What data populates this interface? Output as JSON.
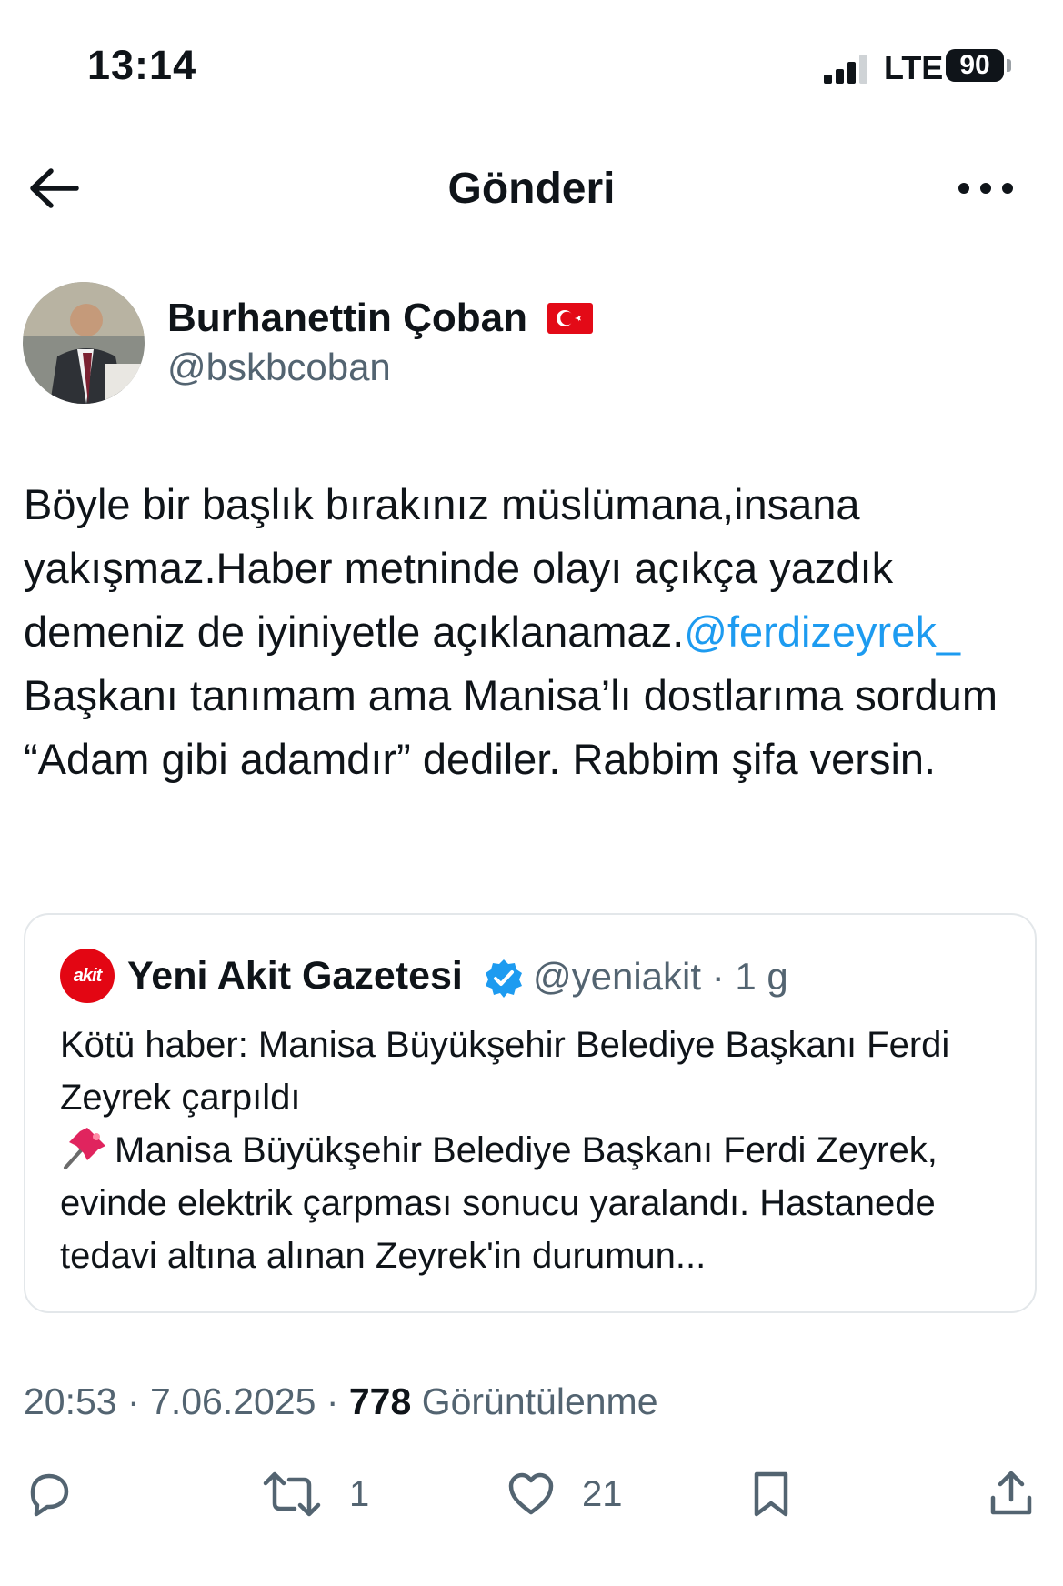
{
  "status_bar": {
    "time": "13:14",
    "network": "LTE",
    "battery": "90"
  },
  "header": {
    "title": "Gönderi",
    "back_icon": "arrow-left-icon",
    "more_icon": "more-horizontal-icon"
  },
  "author": {
    "name": "Burhanettin Çoban",
    "handle": "@bskbcoban",
    "flag_icon": "turkey-flag-icon"
  },
  "tweet": {
    "text_part1": "Böyle bir başlık bırakınız müslümana,insana yakışmaz.Haber metninde olayı açıkça yazdık demeniz de iyiniyetle açıklanamaz.",
    "mention": "@ferdizeyrek_",
    "text_part2": " Başkanı tanımam ama Manisa’lı dostlarıma sordum “Adam gibi adamdır” dediler. Rabbim şifa versin."
  },
  "quote": {
    "logo_text": "akit",
    "name": "Yeni Akit Gazetesi",
    "handle_meta": "@yeniakit · 1 g",
    "line1": "Kötü haber: Manisa Büyükşehir Belediye Başkanı Ferdi Zeyrek çarpıldı",
    "line2": "Manisa Büyükşehir Belediye Başkanı Ferdi Zeyrek, evinde elektrik çarpması sonucu yaralandı. Hastanede tedavi altına alınan Zeyrek'in durumun..."
  },
  "timestamp": {
    "time_date": "20:53 · 7.06.2025 · ",
    "views": "778",
    "views_label": " Görüntülenme"
  },
  "actions": {
    "reply_count": "",
    "retweet_count": "1",
    "like_count": "21"
  },
  "colors": {
    "accent": "#1d9bf0",
    "muted": "#536471",
    "text": "#0f1419",
    "brand_red": "#e30613"
  }
}
